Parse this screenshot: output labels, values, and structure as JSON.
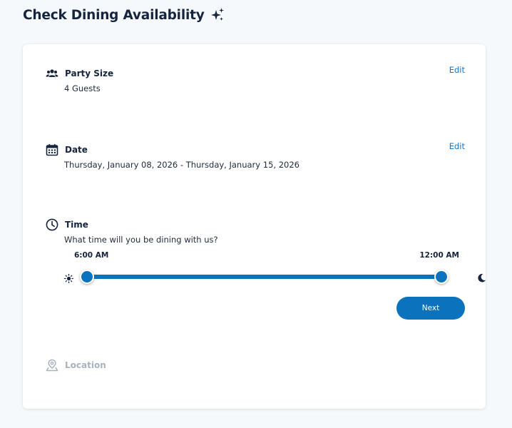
{
  "header": {
    "title": "Check Dining Availability",
    "icon": "sparkle-icon"
  },
  "colors": {
    "accent": "#0b73bd",
    "link": "#1a75c4",
    "title": "#16243d",
    "disabled": "#a9b3bf"
  },
  "party": {
    "title": "Party Size",
    "value": "4 Guests",
    "edit_label": "Edit",
    "icon": "group-icon"
  },
  "date": {
    "title": "Date",
    "value": "Thursday, January 08, 2026 - Thursday, January 15, 2026",
    "edit_label": "Edit",
    "icon": "calendar-icon"
  },
  "time": {
    "title": "Time",
    "prompt": "What time will you be dining with us?",
    "icon": "clock-icon",
    "start_label": "6:00 AM",
    "end_label": "12:00 AM",
    "start_icon": "sun-icon",
    "end_icon": "moon-icon",
    "next_label": "Next"
  },
  "location": {
    "title": "Location",
    "icon": "map-pin-icon"
  }
}
